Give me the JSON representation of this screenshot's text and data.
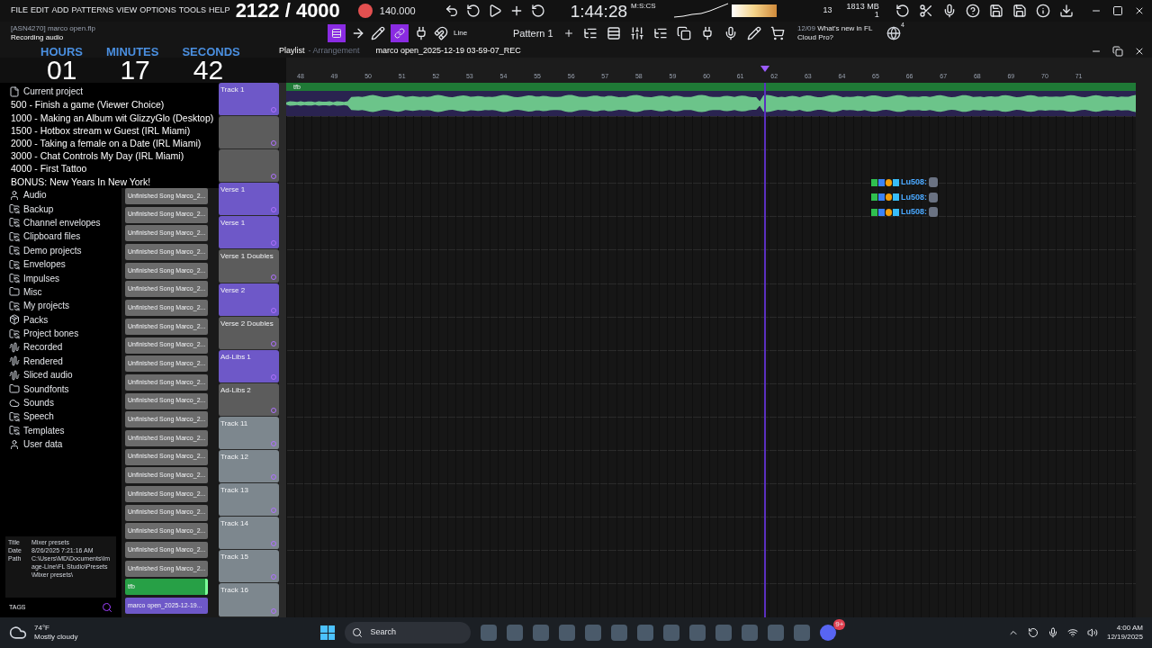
{
  "menu": [
    "FILE",
    "EDIT",
    "ADD",
    "PATTERNS",
    "VIEW",
    "OPTIONS",
    "TOOLS",
    "HELP"
  ],
  "goal_counter": "2122 / 4000",
  "transport": {
    "recording": true,
    "tempo": "140.000",
    "time": "1:44:28",
    "time_unit": "M:S:CS"
  },
  "monitor": {
    "cpu": "13",
    "memory": "1813 MB",
    "voices": "1"
  },
  "project": {
    "file": "[ASN4270] marco open.flp",
    "status": "Recording audio"
  },
  "toolbar": {
    "snap": "Line",
    "pattern": "Pattern 1",
    "news_date": "12/09",
    "news_text": "What's new in FL Cloud Pro?",
    "notifications": "4"
  },
  "stream_timer": {
    "labels": [
      "HOURS",
      "MINUTES",
      "SECONDS"
    ],
    "values": [
      "01",
      "17",
      "42"
    ]
  },
  "playlist": {
    "title": "Playlist",
    "subtitle": "- Arrangement",
    "arrangement": "marco open_2025-12-19 03-59-07_REC",
    "ruler": [
      "48",
      "49",
      "50",
      "51",
      "52",
      "53",
      "54",
      "55",
      "56",
      "57",
      "58",
      "59",
      "60",
      "61",
      "62",
      "63",
      "64",
      "65",
      "66",
      "67",
      "68",
      "69",
      "70",
      "71"
    ],
    "clip": "tfb"
  },
  "browser": {
    "items": [
      {
        "label": "Current project",
        "kind": "file"
      },
      {
        "label": "Audio",
        "kind": "user"
      },
      {
        "label": "Backup",
        "kind": "folder"
      },
      {
        "label": "Channel envelopes",
        "kind": "folder"
      },
      {
        "label": "Clipboard files",
        "kind": "folder"
      },
      {
        "label": "Demo projects",
        "kind": "folder"
      },
      {
        "label": "Envelopes",
        "kind": "folder"
      },
      {
        "label": "Impulses",
        "kind": "folder"
      },
      {
        "label": "Misc",
        "kind": "plain"
      },
      {
        "label": "My projects",
        "kind": "folder"
      },
      {
        "label": "Packs",
        "kind": "packs"
      },
      {
        "label": "Project bones",
        "kind": "folder"
      },
      {
        "label": "Recorded",
        "kind": "audio"
      },
      {
        "label": "Rendered",
        "kind": "audio"
      },
      {
        "label": "Sliced audio",
        "kind": "audio"
      },
      {
        "label": "Soundfonts",
        "kind": "plain"
      },
      {
        "label": "Sounds",
        "kind": "cloud"
      },
      {
        "label": "Speech",
        "kind": "folder"
      },
      {
        "label": "Templates",
        "kind": "folder"
      },
      {
        "label": "User data",
        "kind": "user"
      }
    ],
    "info": [
      {
        "key": "Title",
        "value": "Mixer presets"
      },
      {
        "key": "Date",
        "value": "8/26/2025 7:21:16 AM"
      },
      {
        "key": "Path",
        "value": "C:\\Users\\MD\\Documents\\Image-Line\\FL Studio\\Presets\\Mixer presets\\"
      }
    ],
    "tags": "TAGS"
  },
  "goals": [
    "500 - Finish a game (Viewer Choice)",
    "1000 - Making an Album wit GlizzyGlo (Desktop)",
    "1500 - Hotbox stream w Guest (IRL Miami)",
    "2000 - Taking a female on a Date (IRL Miami)",
    "3000 - Chat Controls My Day (IRL Miami)",
    "4000 - First Tattoo",
    "BONUS: New Years In New York!"
  ],
  "channels": [
    {
      "name": "Unfinished Song Marco_2...",
      "color": "#6b6b6b",
      "selected": false
    },
    {
      "name": "Unfinished Song Marco_2...",
      "color": "#6b6b6b",
      "selected": false
    },
    {
      "name": "Unfinished Song Marco_2...",
      "color": "#6b6b6b",
      "selected": false
    },
    {
      "name": "Unfinished Song Marco_2...",
      "color": "#6b6b6b",
      "selected": false
    },
    {
      "name": "Unfinished Song Marco_2...",
      "color": "#6b6b6b",
      "selected": false
    },
    {
      "name": "Unfinished Song Marco_2...",
      "color": "#6b6b6b",
      "selected": false
    },
    {
      "name": "Unfinished Song Marco_2...",
      "color": "#6b6b6b",
      "selected": false
    },
    {
      "name": "Unfinished Song Marco_2...",
      "color": "#6b6b6b",
      "selected": false
    },
    {
      "name": "Unfinished Song Marco_2...",
      "color": "#6b6b6b",
      "selected": false
    },
    {
      "name": "Unfinished Song Marco_2...",
      "color": "#6b6b6b",
      "selected": false
    },
    {
      "name": "Unfinished Song Marco_2...",
      "color": "#6b6b6b",
      "selected": false
    },
    {
      "name": "Unfinished Song Marco_2...",
      "color": "#6b6b6b",
      "selected": false
    },
    {
      "name": "Unfinished Song Marco_2...",
      "color": "#6b6b6b",
      "selected": false
    },
    {
      "name": "Unfinished Song Marco_2...",
      "color": "#6b6b6b",
      "selected": false
    },
    {
      "name": "Unfinished Song Marco_2...",
      "color": "#6b6b6b",
      "selected": false
    },
    {
      "name": "Unfinished Song Marco_2...",
      "color": "#6b6b6b",
      "selected": false
    },
    {
      "name": "Unfinished Song Marco_2...",
      "color": "#6b6b6b",
      "selected": false
    },
    {
      "name": "Unfinished Song Marco_2...",
      "color": "#6b6b6b",
      "selected": false
    },
    {
      "name": "Unfinished Song Marco_2...",
      "color": "#6b6b6b",
      "selected": false
    },
    {
      "name": "Unfinished Song Marco_2...",
      "color": "#6b6b6b",
      "selected": false
    },
    {
      "name": "Unfinished Song Marco_2...",
      "color": "#6b6b6b",
      "selected": false
    },
    {
      "name": "tfb",
      "color": "#27a046",
      "selected": true
    },
    {
      "name": "marco open_2025-12-19...",
      "color": "#6e58c8",
      "selected": false
    }
  ],
  "tracks": [
    {
      "name": "Track 1",
      "color": "#6e58c8"
    },
    {
      "color": "#5c5c5c"
    },
    {
      "color": "#5c5c5c"
    },
    {
      "name": "Verse 1",
      "color": "#6e58c8"
    },
    {
      "name": "Verse 1",
      "color": "#6e58c8"
    },
    {
      "name": "Verse 1 Doubles",
      "color": "#5c5c5c"
    },
    {
      "name": "Verse 2",
      "color": "#6e58c8"
    },
    {
      "name": "Verse 2 Doubles",
      "color": "#5c5c5c"
    },
    {
      "name": "Ad-Libs 1",
      "color": "#6e58c8"
    },
    {
      "name": "Ad-Libs 2",
      "color": "#5c5c5c"
    },
    {
      "name": "Track 11",
      "color": "#7d878e"
    },
    {
      "name": "Track 12",
      "color": "#7d878e"
    },
    {
      "name": "Track 13",
      "color": "#7d878e"
    },
    {
      "name": "Track 14",
      "color": "#7d878e"
    },
    {
      "name": "Track 15",
      "color": "#7d878e"
    },
    {
      "name": "Track 16",
      "color": "#7d878e"
    }
  ],
  "chat": [
    {
      "user": "Lu508:"
    },
    {
      "user": "Lu508:"
    },
    {
      "user": "Lu508:"
    }
  ],
  "taskbar": {
    "temperature": "74°F",
    "weather": "Mostly cloudy",
    "search_placeholder": "Search",
    "badge": "9+",
    "time": "4:00 AM",
    "date": "12/19/2025"
  }
}
